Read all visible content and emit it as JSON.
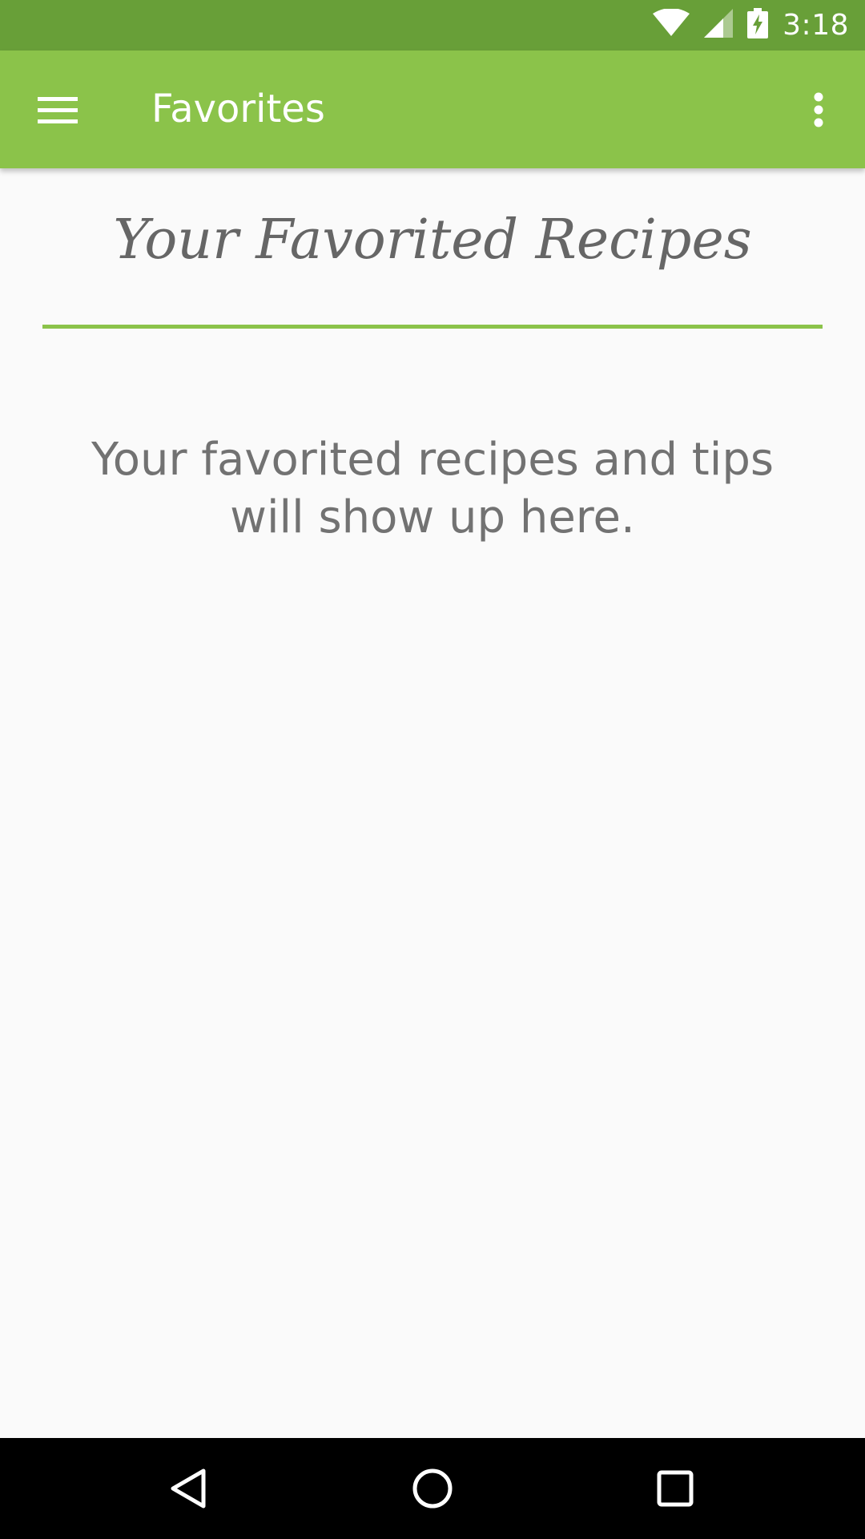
{
  "status_bar": {
    "time": "3:18",
    "icons": [
      "wifi-icon",
      "cell-signal-icon",
      "battery-charging-icon"
    ]
  },
  "app_bar": {
    "title": "Favorites",
    "menu_icon": "hamburger-menu-icon",
    "overflow_icon": "more-vert-icon"
  },
  "content": {
    "heading": "Your Favorited Recipes",
    "empty_message": "Your favorited recipes and tips will show up here."
  },
  "nav_bar": {
    "icons": [
      "back-icon",
      "home-icon",
      "recents-icon"
    ]
  },
  "colors": {
    "status_bar": "#689f38",
    "app_bar": "#8bc34a",
    "divider": "#8bc34a",
    "background": "#fafafa",
    "text_muted": "#727272"
  }
}
